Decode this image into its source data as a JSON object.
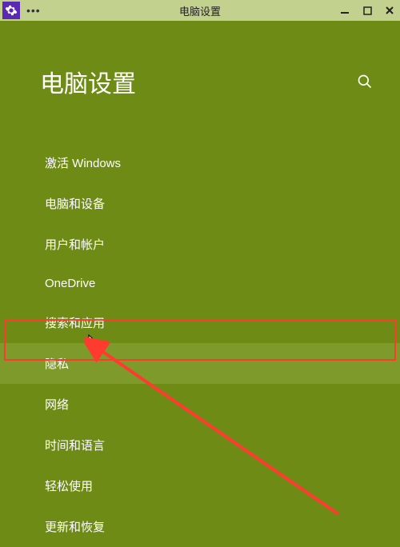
{
  "titleBar": {
    "title": "电脑设置",
    "icon": "gear-icon"
  },
  "header": {
    "title": "电脑设置"
  },
  "menu": {
    "items": [
      {
        "label": "激活 Windows",
        "highlighted": false
      },
      {
        "label": "电脑和设备",
        "highlighted": false
      },
      {
        "label": "用户和帐户",
        "highlighted": false
      },
      {
        "label": "OneDrive",
        "highlighted": false
      },
      {
        "label": "搜索和应用",
        "highlighted": false
      },
      {
        "label": "隐私",
        "highlighted": true
      },
      {
        "label": "网络",
        "highlighted": false
      },
      {
        "label": "时间和语言",
        "highlighted": false
      },
      {
        "label": "轻松使用",
        "highlighted": false
      },
      {
        "label": "更新和恢复",
        "highlighted": false
      }
    ]
  }
}
